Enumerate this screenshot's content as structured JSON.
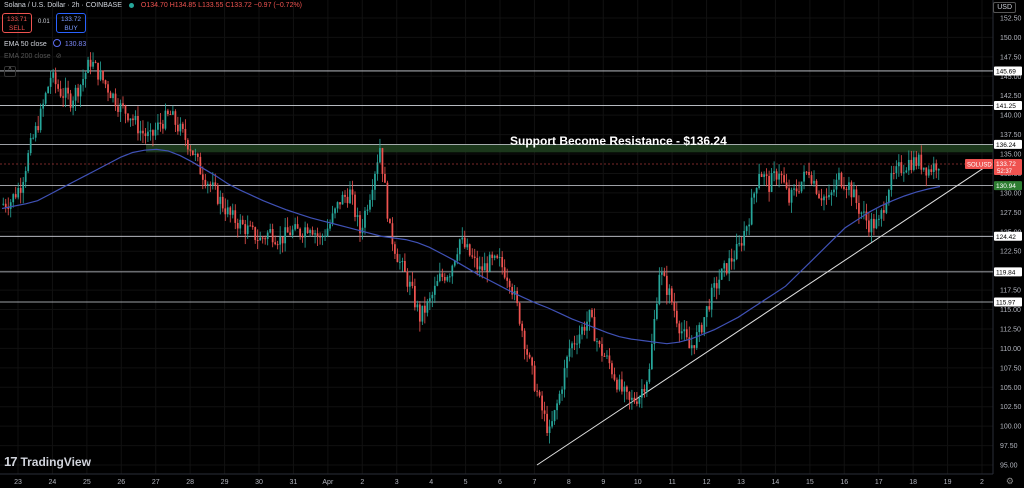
{
  "header": {
    "symbol_text": "Solana / U.S. Dollar · 2h · COINBASE",
    "ohlc_text": "O134.70 H134.85 L133.55 C133.72 −0.97 (−0.72%)",
    "sell_price": "133.71",
    "sell_label": "SELL",
    "buy_price": "133.72",
    "buy_label": "BUY",
    "spread": "0.01"
  },
  "indicators": {
    "ema50_label": "EMA 50 close",
    "ema50_value": "130.83",
    "ema200_label": "EMA 200 close"
  },
  "currency": "USD",
  "logo_text": "TradingView",
  "colors": {
    "background": "#000000",
    "up": "#26a69a",
    "down": "#ef5350",
    "ema": "#3f51b5",
    "zone": "#1e3d1e",
    "support_tag": "#2e7d32"
  },
  "chart_data": {
    "type": "candlestick",
    "symbol": "SOLUSD",
    "last_price": 133.72,
    "countdown": "52:37",
    "annotation": "Support Become Resistance - $136.24",
    "ylim": [
      93.0,
      155.0
    ],
    "y_ticks": [
      "95.00",
      "97.50",
      "100.00",
      "102.50",
      "105.00",
      "107.50",
      "110.00",
      "112.50",
      "115.00",
      "117.50",
      "120.00",
      "122.50",
      "125.00",
      "127.50",
      "130.00",
      "132.50",
      "135.00",
      "137.50",
      "140.00",
      "142.50",
      "145.00",
      "147.50",
      "150.00",
      "152.50"
    ],
    "x_ticks": [
      "23",
      "24",
      "25",
      "26",
      "27",
      "28",
      "29",
      "30",
      "31",
      "Apr",
      "2",
      "3",
      "4",
      "5",
      "6",
      "7",
      "8",
      "9",
      "10",
      "11",
      "12",
      "13",
      "14",
      "15",
      "16",
      "17",
      "18",
      "19",
      "2"
    ],
    "horizontal_levels": [
      145.69,
      141.25,
      136.24,
      130.94,
      124.42,
      119.84,
      115.97
    ],
    "resistance_zone": [
      135.6,
      136.24
    ],
    "price_path": [
      128.5,
      129,
      131,
      136,
      140,
      145,
      143,
      142,
      144,
      147,
      145,
      143,
      141,
      140,
      138,
      137,
      139,
      140,
      138,
      136,
      133,
      131,
      129,
      127,
      126,
      125,
      124,
      125,
      124,
      125,
      125,
      126,
      124,
      126,
      129,
      130,
      125,
      130,
      136,
      125,
      121,
      118,
      114,
      116,
      119,
      120,
      124,
      122,
      120,
      121,
      121,
      119,
      114,
      108,
      103,
      99,
      104,
      110,
      112,
      114,
      110,
      108,
      105,
      103,
      104,
      107,
      120,
      117,
      113,
      110,
      112,
      116,
      119,
      121,
      123,
      127,
      133,
      131,
      133,
      129,
      131,
      133,
      130,
      129,
      132,
      131,
      128,
      126,
      126,
      131,
      133,
      134,
      134,
      133,
      134
    ],
    "ema50_path": [
      128,
      128.3,
      128.6,
      129,
      129.8,
      130.6,
      131.4,
      132.2,
      133,
      133.8,
      134.6,
      135.2,
      135.5,
      135.6,
      135.4,
      134.8,
      134,
      133.1,
      132.2,
      131.2,
      130.4,
      129.7,
      129,
      128.4,
      127.8,
      127.3,
      126.8,
      126.4,
      126,
      125.6,
      125.2,
      124.8,
      124.4,
      124.2,
      124,
      123.6,
      123,
      122.2,
      121.4,
      120.5,
      119.6,
      118.8,
      118,
      117.2,
      116.5,
      115.8,
      115.2,
      114.5,
      113.8,
      113.2,
      112.6,
      112,
      111.5,
      111.2,
      111,
      110.8,
      110.6,
      110.8,
      111.2,
      111.8,
      112.4,
      113.2,
      114,
      115,
      116,
      117,
      118,
      119.5,
      121,
      122.5,
      124,
      125.5,
      126.5,
      127.5,
      128.3,
      129,
      129.6,
      130.1,
      130.5,
      130.83
    ]
  }
}
